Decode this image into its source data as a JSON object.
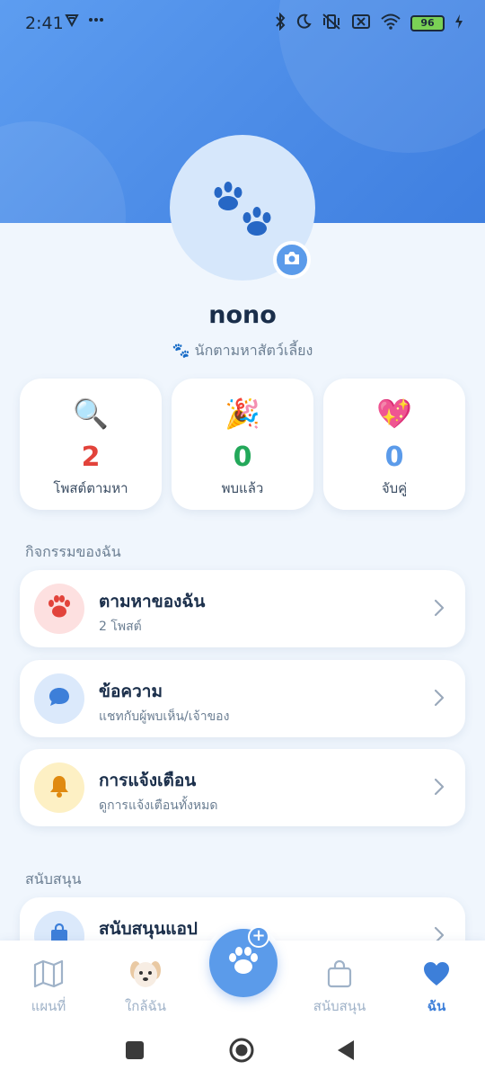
{
  "status_bar": {
    "time": "2:41",
    "left_icons": [
      "vpn-icon",
      "more-icon"
    ],
    "battery": "96",
    "right_icons": [
      "bluetooth-icon",
      "moon-icon",
      "vibrate-off-icon",
      "sim-off-icon",
      "wifi-icon",
      "battery-icon",
      "charging-icon"
    ]
  },
  "profile": {
    "avatar_icon": "paw-icon",
    "name": "nono",
    "badge_emoji": "🐾",
    "subtitle": "นักตามหาสัตว์เลี้ยง"
  },
  "stats": [
    {
      "emoji": "🔍",
      "value": "2",
      "label": "โพสต์ตามหา",
      "color": "#e2433b"
    },
    {
      "emoji": "🎉",
      "value": "0",
      "label": "พบแล้ว",
      "color": "#23a85a"
    },
    {
      "emoji": "💖",
      "value": "0",
      "label": "จับคู่",
      "color": "#5b9bea"
    }
  ],
  "sections": {
    "activity": "กิจกรรมของฉัน",
    "support": "สนับสนุน"
  },
  "menu": [
    {
      "title": "ตามหาของฉัน",
      "subtitle": "2 โพสต์",
      "icon": "paw-icon",
      "icon_bg": "#fde0e0",
      "icon_color": "#e2433b"
    },
    {
      "title": "ข้อความ",
      "subtitle": "แชทกับผู้พบเห็น/เจ้าของ",
      "icon": "chat-icon",
      "icon_bg": "#dbe9fb",
      "icon_color": "#3d7fd9"
    },
    {
      "title": "การแจ้งเตือน",
      "subtitle": "ดูการแจ้งเตือนทั้งหมด",
      "icon": "bell-icon",
      "icon_bg": "#fdf0c4",
      "icon_color": "#e08a10"
    },
    {
      "title": "สนับสนุนแอป",
      "icon": "shopping-bag-icon",
      "icon_bg": "#dbe9fb",
      "icon_color": "#3d7fd9"
    }
  ],
  "bottom_nav": [
    {
      "label": "แผนที่",
      "icon": "map-icon",
      "active": false
    },
    {
      "label": "ใกล้ฉัน",
      "icon": "dog-icon",
      "active": false
    },
    {
      "label": "สนับสนุน",
      "icon": "shopping-bag-icon",
      "active": false
    },
    {
      "label": "ฉัน",
      "icon": "heart-icon",
      "active": true
    }
  ],
  "colors": {
    "primary": "#5b9bea",
    "active_nav": "#3d7fd9",
    "inactive_nav": "#9fb2c8",
    "background": "#f0f6fd"
  }
}
